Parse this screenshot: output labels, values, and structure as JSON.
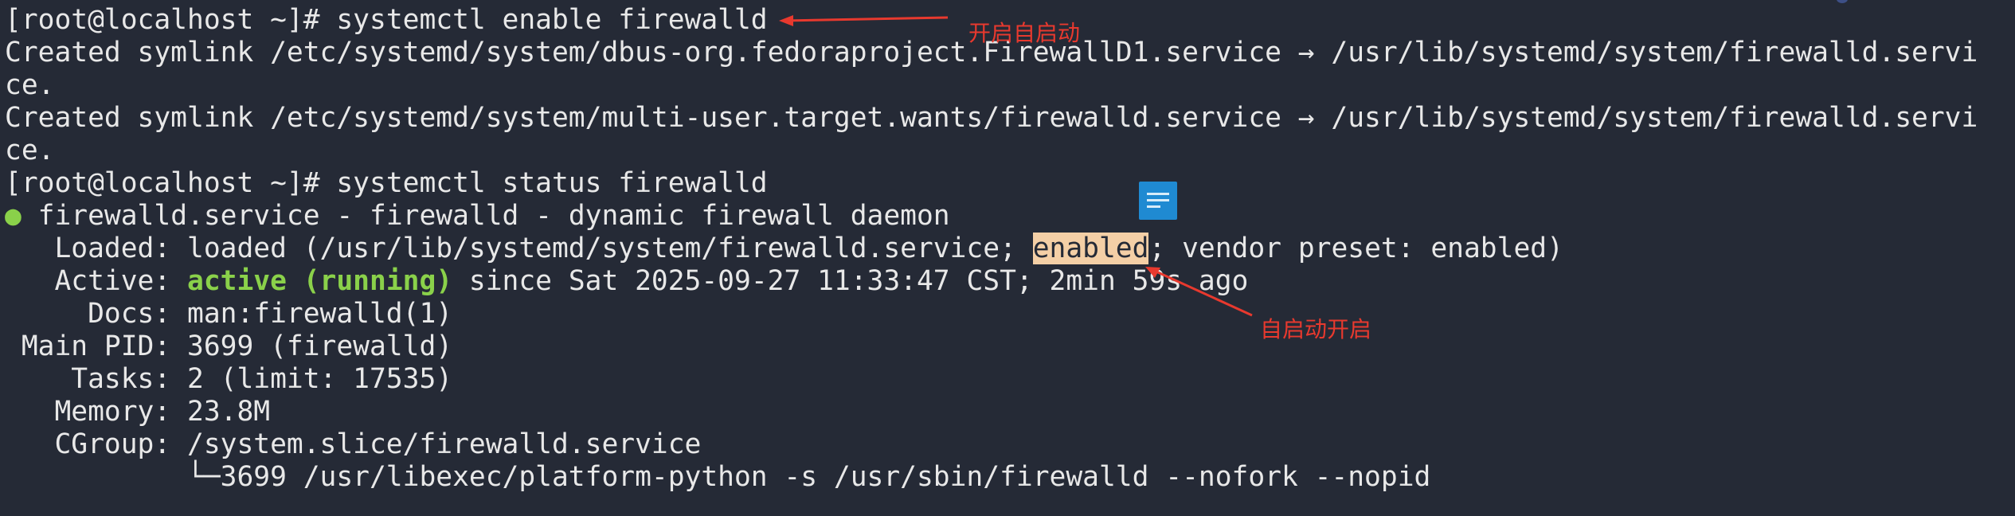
{
  "terminal": {
    "line1": {
      "prompt": "[root@localhost ~]# ",
      "command": "systemctl enable firewalld"
    },
    "line2": "Created symlink /etc/systemd/system/dbus-org.fedoraproject.FirewallD1.service → /usr/lib/systemd/system/firewalld.servi",
    "line3": "ce.",
    "line4": "Created symlink /etc/systemd/system/multi-user.target.wants/firewalld.service → /usr/lib/systemd/system/firewalld.servi",
    "line5": "ce.",
    "line6": {
      "prompt": "[root@localhost ~]# ",
      "command": "systemctl status firewalld"
    },
    "line7": {
      "bullet": "●",
      "text": " firewalld.service - firewalld - dynamic firewall daemon"
    },
    "line8": {
      "before": "   Loaded: loaded (/usr/lib/systemd/system/firewalld.service; ",
      "highlight": "enabled",
      "after": "; vendor preset: enabled)"
    },
    "line9": {
      "before": "   Active: ",
      "status": "active (running)",
      "after": " since Sat 2025-09-27 11:33:47 CST; 2min 59s ago"
    },
    "line10": "     Docs: man:firewalld(1)",
    "line11": " Main PID: 3699 (firewalld)",
    "line12": "    Tasks: 2 (limit: 17535)",
    "line13": "   Memory: 23.8M",
    "line14": "   CGroup: /system.slice/firewalld.service",
    "line15": "           └─3699 /usr/libexec/platform-python -s /usr/sbin/firewalld --nofork --nopid"
  },
  "annotations": {
    "enable_note": "开启自启动",
    "enabled_note": "自启动开启"
  },
  "colors": {
    "background": "#252a36",
    "text": "#e8e8e8",
    "active": "#8ad14a",
    "highlight": "#f4cfa6",
    "annotation": "#e8392e",
    "note_icon": "#1f8ad2"
  }
}
